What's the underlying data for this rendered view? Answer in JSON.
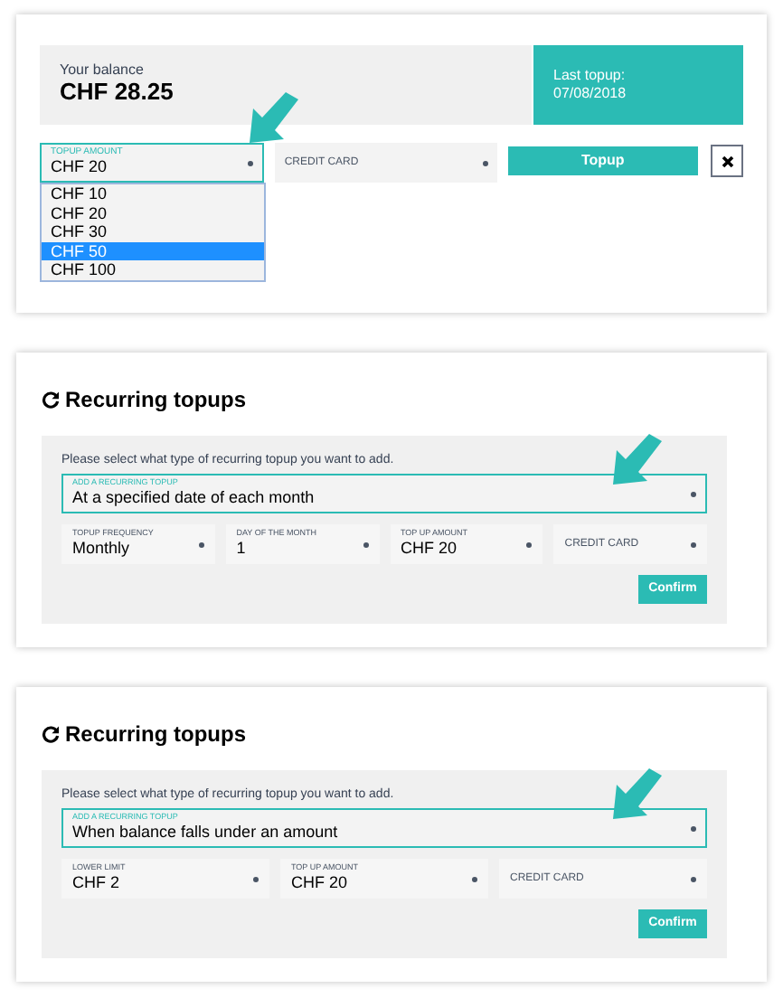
{
  "balance": {
    "label": "Your balance",
    "amount": "CHF 28.25"
  },
  "last_topup": {
    "label": "Last topup:",
    "date": "07/08/2018"
  },
  "topup_form": {
    "amount_select": {
      "label": "TOPUP AMOUNT",
      "value": "CHF 20",
      "expanded": true,
      "options": [
        {
          "label": "CHF 10",
          "highlighted": false
        },
        {
          "label": "CHF 20",
          "highlighted": false
        },
        {
          "label": "CHF 30",
          "highlighted": false
        },
        {
          "label": "CHF 50",
          "highlighted": true
        },
        {
          "label": "CHF 100",
          "highlighted": false
        }
      ]
    },
    "payment_select": {
      "label": "CREDIT CARD"
    },
    "submit": "Topup"
  },
  "recurring_panels": [
    {
      "title": "Recurring topups",
      "prompt": "Please select what type of recurring topup you want to add.",
      "type_select": {
        "label": "ADD A RECURRING TOPUP",
        "value": "At a specified date of each month"
      },
      "fields": [
        {
          "label": "TOPUP FREQUENCY",
          "value": "Monthly"
        },
        {
          "label": "DAY OF THE MONTH",
          "value": "1"
        },
        {
          "label": "TOP UP AMOUNT",
          "value": "CHF 20"
        },
        {
          "label": "CREDIT CARD"
        }
      ],
      "confirm": "Confirm"
    },
    {
      "title": "Recurring topups",
      "prompt": "Please select what type of recurring topup you want to add.",
      "type_select": {
        "label": "ADD A RECURRING TOPUP",
        "value": "When balance falls under an amount"
      },
      "fields": [
        {
          "label": "LOWER LIMIT",
          "value": "CHF 2"
        },
        {
          "label": "TOP UP AMOUNT",
          "value": "CHF 20"
        },
        {
          "label": "CREDIT CARD"
        }
      ],
      "confirm": "Confirm"
    }
  ]
}
